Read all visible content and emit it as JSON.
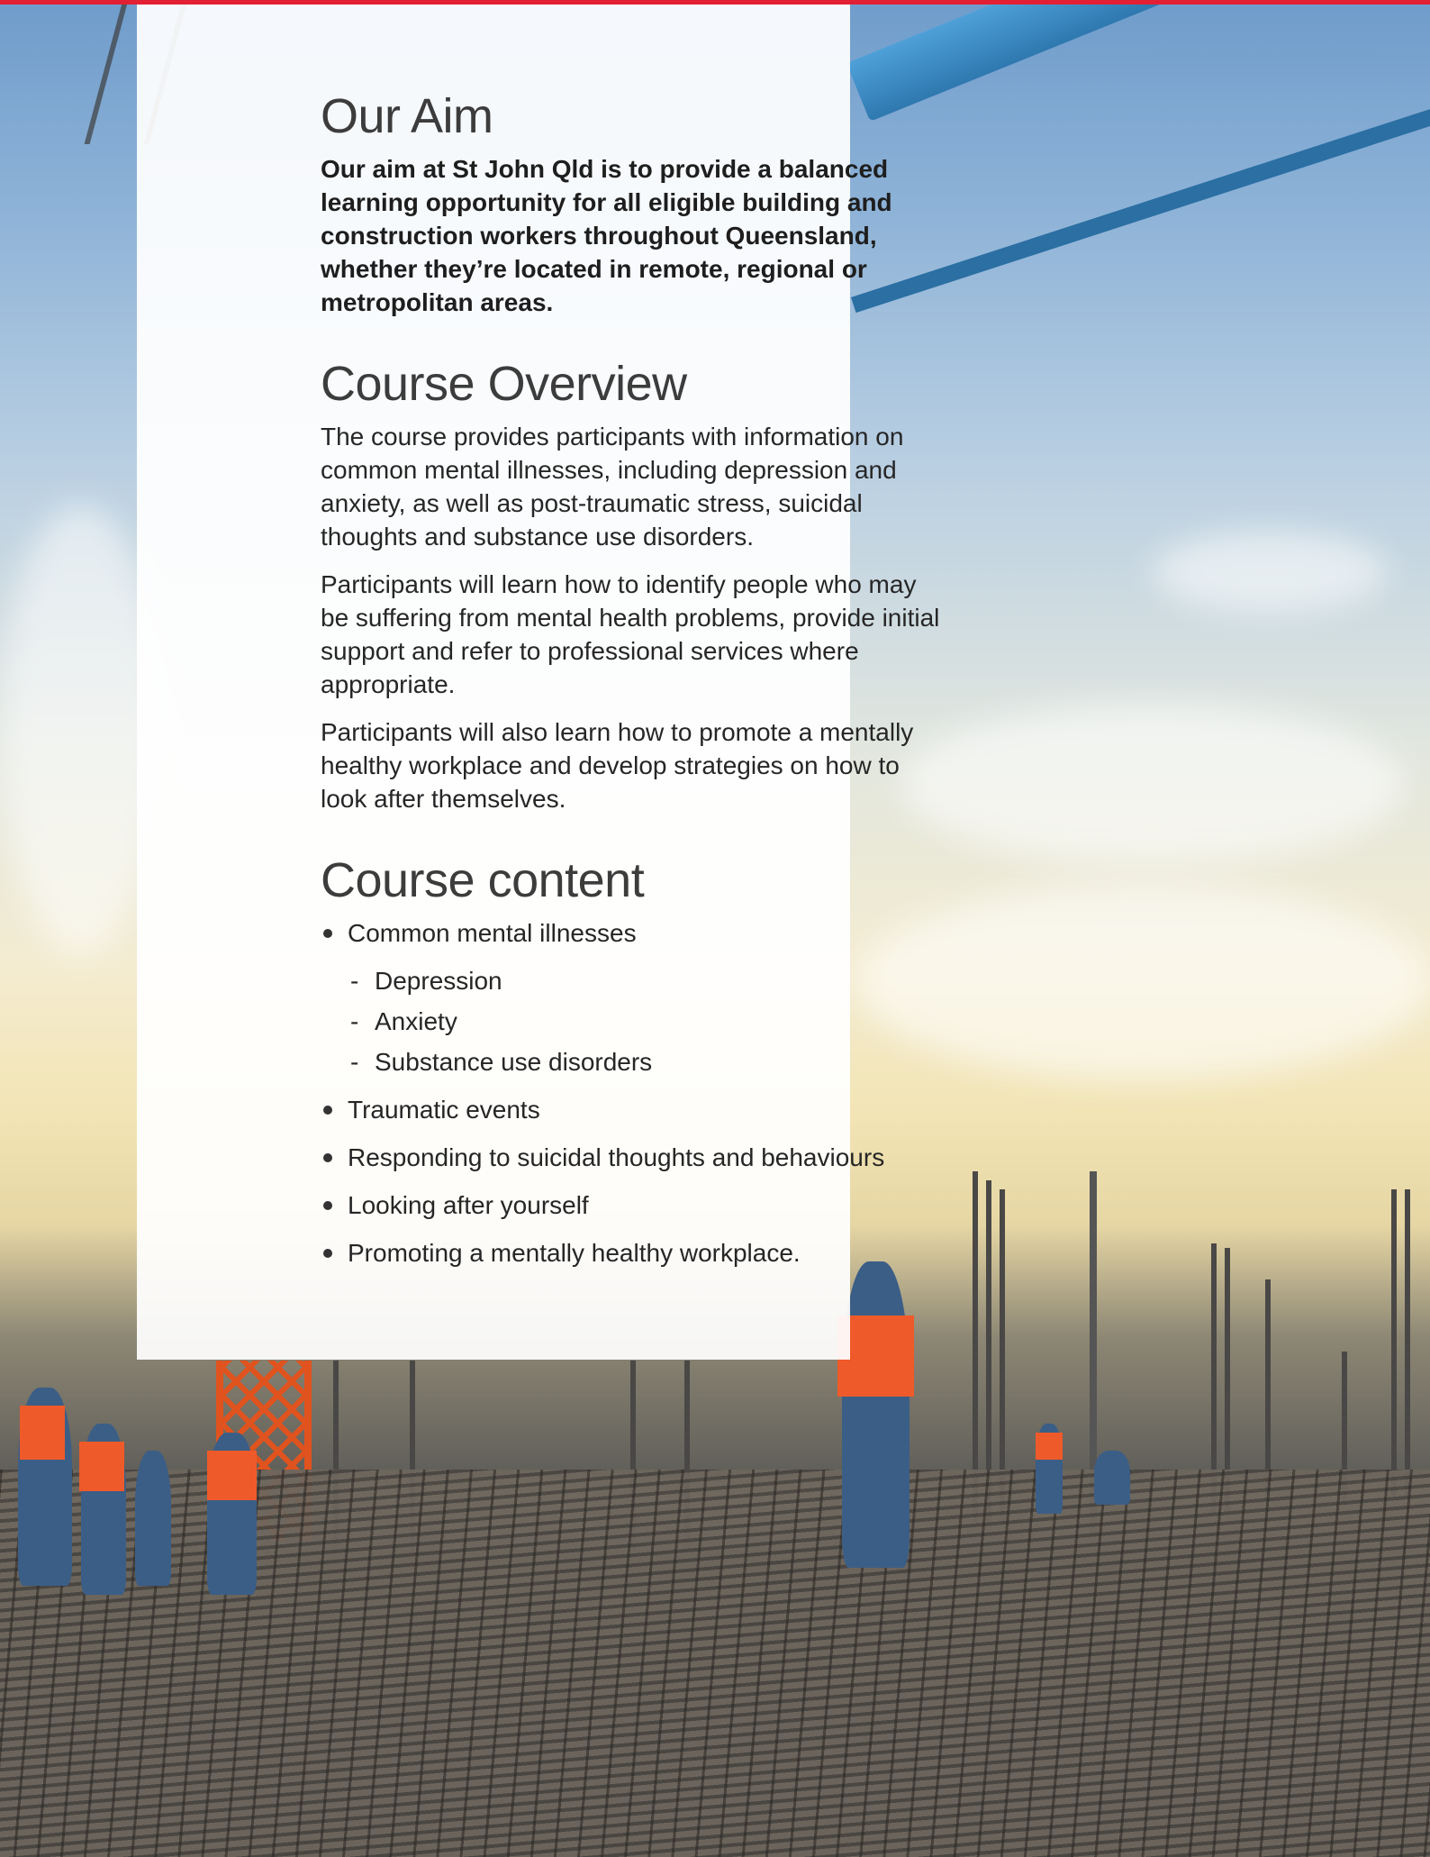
{
  "colors": {
    "accent_bar": "#e31f33",
    "heading": "#3c3c3c",
    "body": "#262626"
  },
  "aim": {
    "title": "Our Aim",
    "text": "Our aim at St John Qld is to provide a balanced learning opportunity for all eligible building and construction workers throughout Queensland, whether they’re located in remote, regional or metropolitan areas."
  },
  "overview": {
    "title": "Course Overview",
    "paragraphs": [
      "The course provides participants with information on common mental illnesses, including depression and anxiety, as well as post-traumatic stress, suicidal thoughts and substance use disorders.",
      "Participants will learn how to identify people who may be suffering from mental health problems, provide initial support and refer to professional services where appropriate.",
      "Participants will also learn how to promote a mentally healthy workplace and develop strategies on how to look after themselves."
    ]
  },
  "content": {
    "title": "Course content",
    "items": [
      {
        "label": "Common mental illnesses",
        "subitems": [
          "Depression",
          "Anxiety",
          "Substance use disorders"
        ]
      },
      {
        "label": "Traumatic events"
      },
      {
        "label": "Responding to suicidal thoughts and behaviours"
      },
      {
        "label": "Looking after yourself"
      },
      {
        "label": "Promoting a mentally healthy workplace."
      }
    ]
  }
}
